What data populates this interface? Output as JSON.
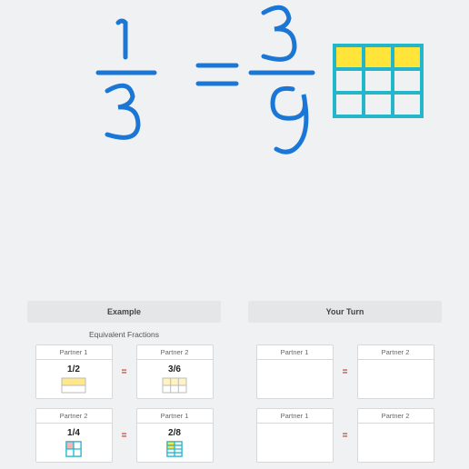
{
  "whiteboard": {
    "fraction_left": {
      "numerator": "1",
      "denominator": "3"
    },
    "equals": "=",
    "fraction_right": {
      "numerator": "3",
      "denominator": "9"
    },
    "diagram": {
      "rows": 3,
      "cols": 3,
      "shaded_row": 0
    }
  },
  "example": {
    "header": "Example",
    "subtitle": "Equivalent Fractions",
    "row1": {
      "left": {
        "partner": "Partner 1",
        "fraction": "1/2",
        "diagram": "half"
      },
      "right": {
        "partner": "Partner 2",
        "fraction": "3/6",
        "diagram": "sixths"
      },
      "op": "="
    },
    "row2": {
      "left": {
        "partner": "Partner 2",
        "fraction": "1/4",
        "diagram": "quarter"
      },
      "right": {
        "partner": "Partner 1",
        "fraction": "2/8",
        "diagram": "eighths"
      },
      "op": "="
    }
  },
  "yourturn": {
    "header": "Your Turn",
    "row1": {
      "left": {
        "partner": "Partner 1"
      },
      "right": {
        "partner": "Partner 2"
      },
      "op": "="
    },
    "row2": {
      "left": {
        "partner": "Partner 1"
      },
      "right": {
        "partner": "Partner 2"
      },
      "op": "="
    }
  },
  "colors": {
    "ink": "#1b77d6",
    "highlight": "#ffe43a",
    "grid": "#26b6c9",
    "red": "#e04a3a"
  }
}
